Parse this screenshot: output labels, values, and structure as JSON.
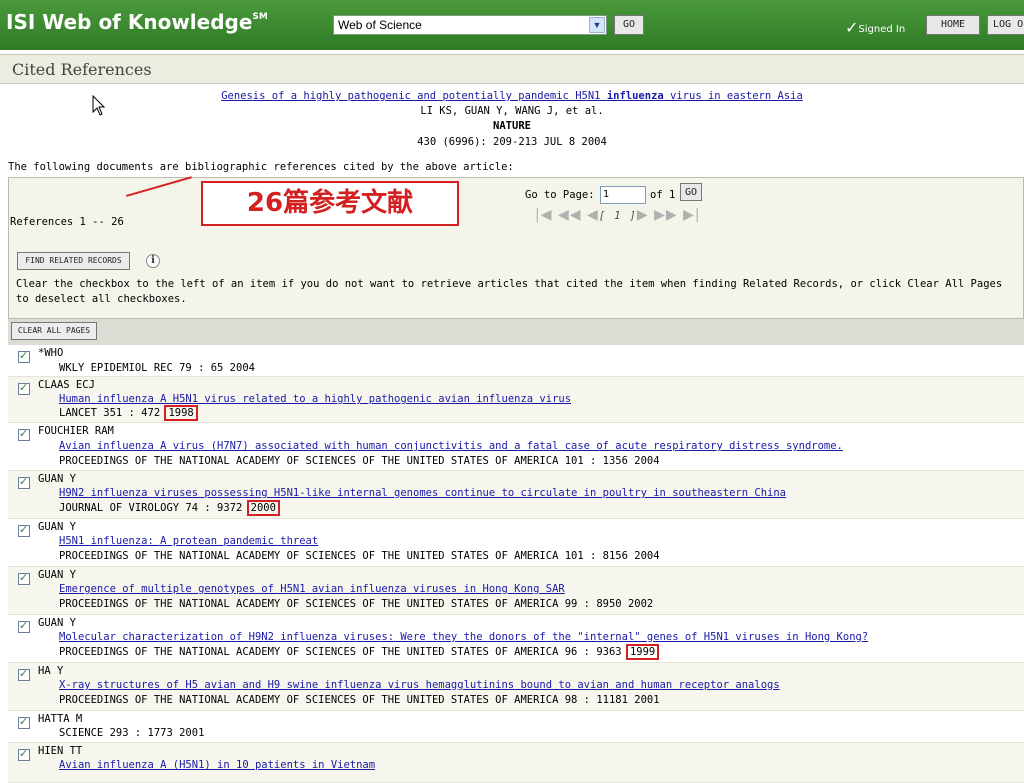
{
  "header": {
    "brand": "ISI Web of Knowledge",
    "brand_sup": "SM",
    "database": "Web of Science",
    "go_label": "GO",
    "signed_in": "Signed In",
    "home_label": "HOME",
    "logout_label": "LOG O"
  },
  "page_title": "Cited References",
  "article": {
    "title_pre": "Genesis of a highly pathogenic and potentially pandemic H5N1 ",
    "title_bold": "influenza",
    "title_post": " virus in eastern Asia",
    "authors": "LI KS, GUAN Y, WANG J, et al.",
    "journal": "NATURE",
    "citation": "430 (6996): 209-213 JUL 8 2004"
  },
  "intro_text": "The following documents are bibliographic references cited by the above article:",
  "nav": {
    "range": "References 1 -- 26",
    "annotation": "26篇参考文献",
    "goto_label": "Go to Page:",
    "page_value": "1",
    "of_label": "of 1",
    "go_label": "GO",
    "current_page": "[ 1 ]"
  },
  "find_related_label": "FIND RELATED RECORDS",
  "clear_message": "Clear the checkbox to the left of an item if you do not want to retrieve articles that cited the item when finding Related Records, or click Clear All Pages to deselect all checkboxes.",
  "clear_all_label": "CLEAR ALL PAGES",
  "references": [
    {
      "author": "*WHO",
      "title": "",
      "source": "WKLY EPIDEMIOL REC 79 : 65 2004",
      "year": ""
    },
    {
      "author": "CLAAS ECJ",
      "title": "Human influenza A H5N1 virus related to a highly pathogenic avian influenza virus",
      "source": "LANCET 351 : 472 ",
      "year": "1998"
    },
    {
      "author": "FOUCHIER RAM",
      "title": "Avian influenza A virus (H7N7) associated with human conjunctivitis and a fatal case of acute respiratory distress syndrome.",
      "source": "PROCEEDINGS OF THE NATIONAL ACADEMY OF SCIENCES OF THE UNITED STATES OF AMERICA 101 : 1356 2004",
      "year": ""
    },
    {
      "author": "GUAN Y",
      "title": "H9N2 influenza viruses possessing H5N1-like internal genomes continue to circulate in poultry in southeastern China",
      "source": "JOURNAL OF VIROLOGY 74 : 9372 ",
      "year": "2000"
    },
    {
      "author": "GUAN Y",
      "title": "H5N1 influenza: A protean pandemic threat",
      "source": "PROCEEDINGS OF THE NATIONAL ACADEMY OF SCIENCES OF THE UNITED STATES OF AMERICA 101 : 8156 2004",
      "year": ""
    },
    {
      "author": "GUAN Y",
      "title": "Emergence of multiple genotypes of H5N1 avian influenza viruses in Hong Kong SAR",
      "source": "PROCEEDINGS OF THE NATIONAL ACADEMY OF SCIENCES OF THE UNITED STATES OF AMERICA 99 : 8950 2002",
      "year": ""
    },
    {
      "author": "GUAN Y",
      "title": "Molecular characterization of H9N2 influenza viruses: Were they the donors of the \"internal\" genes of H5N1 viruses in Hong Kong?",
      "source": "PROCEEDINGS OF THE NATIONAL ACADEMY OF SCIENCES OF THE UNITED STATES OF AMERICA 96 : 9363 ",
      "year": "1999"
    },
    {
      "author": "HA Y",
      "title": "X-ray structures of H5 avian and H9 swine influenza virus hemagglutinins bound to avian and human receptor analogs",
      "source": "PROCEEDINGS OF THE NATIONAL ACADEMY OF SCIENCES OF THE UNITED STATES OF AMERICA 98 : 11181 2001",
      "year": ""
    },
    {
      "author": "HATTA M",
      "title": "",
      "source": "SCIENCE 293 : 1773 2001",
      "year": ""
    },
    {
      "author": "HIEN TT",
      "title": "Avian influenza A (H5N1) in 10 patients in Vietnam",
      "source": "",
      "year": ""
    }
  ]
}
